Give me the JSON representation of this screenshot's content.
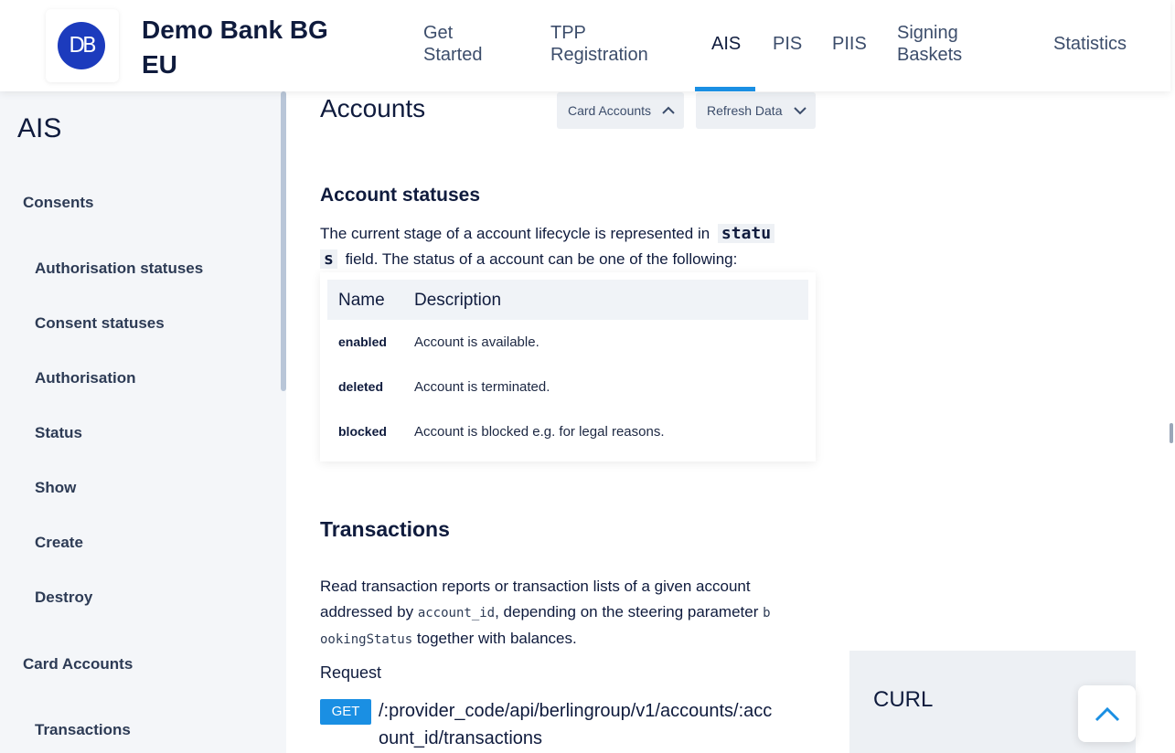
{
  "brand": {
    "logo_text": "DB",
    "name": "Demo Bank BG EU"
  },
  "nav": {
    "get_started": "Get Started",
    "tpp_registration": "TPP Registration",
    "ais": "AIS",
    "pis": "PIS",
    "piis": "PIIS",
    "signing_baskets": "Signing Baskets",
    "statistics": "Statistics",
    "active": "AIS"
  },
  "sidebar": {
    "title": "AIS",
    "items": [
      {
        "label": "Consents"
      },
      {
        "label": "Authorisation statuses"
      },
      {
        "label": "Consent statuses"
      },
      {
        "label": "Authorisation"
      },
      {
        "label": "Status"
      },
      {
        "label": "Show"
      },
      {
        "label": "Create"
      },
      {
        "label": "Destroy"
      },
      {
        "label": "Card Accounts"
      },
      {
        "label": "Transactions"
      }
    ]
  },
  "main": {
    "title": "Accounts",
    "dropdown_card_accounts": "Card Accounts",
    "dropdown_refresh_data": "Refresh Data",
    "account_statuses": {
      "heading": "Account statuses",
      "intro_before": "The current stage of a account lifecycle is represented in",
      "intro_code_a": "statu",
      "intro_code_b": "s",
      "intro_after": "field. The status of a account can be one of the following:",
      "table": {
        "col_name": "Name",
        "col_description": "Description",
        "rows": [
          {
            "name": "enabled",
            "description": "Account is available."
          },
          {
            "name": "deleted",
            "description": "Account is terminated."
          },
          {
            "name": "blocked",
            "description": "Account is blocked e.g. for legal reasons."
          }
        ]
      }
    },
    "transactions": {
      "heading": "Transactions",
      "line1": "Read transaction reports or transaction lists of a given account",
      "line2_before": "addressed by",
      "line2_code": "account_id",
      "line2_after": ", depending on the steering parameter",
      "line2_code_b": "b",
      "line3_code": "ookingStatus",
      "line3_after": "together with balances.",
      "request_label": "Request",
      "method": "GET",
      "path_line1": "/:provider_code/api/berlingroup/v1/accounts/:acc",
      "path_line2": "ount_id/transactions"
    },
    "curl_label": "CURL"
  },
  "colors": {
    "accent": "#1a8fe3",
    "logo_bg": "#1c3bbd"
  },
  "icons": {
    "dropdown_open": "chevron-up-icon",
    "dropdown_closed": "chevron-down-icon",
    "scroll_top": "chevron-up-icon"
  }
}
